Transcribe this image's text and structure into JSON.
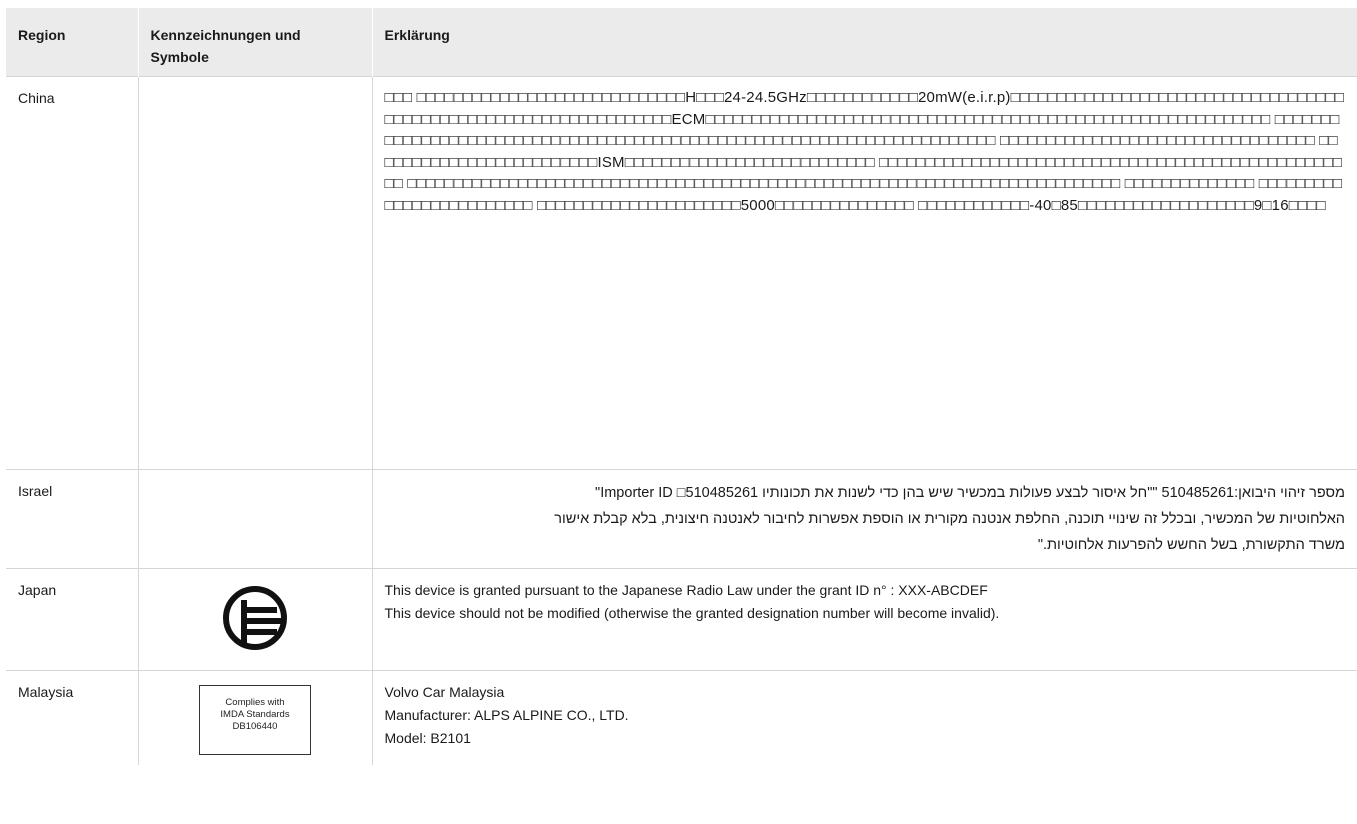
{
  "headers": {
    "region": "Region",
    "symbols": "Kennzeichnungen und Symbole",
    "explanation": "Erklärung"
  },
  "rows": {
    "china": {
      "region": "China",
      "text": "□□□ □□□□□□□□□□□□□□□□□□□□□□□□□□□□□H□□□24-24.5GHz□□□□□□□□□□□□20mW(e.i.r.p)□□□□□□□□□□□□□□□□□□□□□□□□□□□□□□□□□□□□□□□□□□□□□□□□□□□□□□□□□□□□□□□□□□□ECM□□□□□□□□□□□□□□□□□□□□□□□□□□□□□□□□□□□□□□□□□□□□□□□□□□□□□□□□□□□□□ □□□□□□□□□□□□□□□□□□□□□□□□□□□□□□□□□□□□□□□□□□□□□□□□□□□□□□□□□□□□□□□□□□□□□□□□□ □□□□□□□□□□□□□□□□□□□□□□□□□□□□□□□□□□ □□□□□□□□□□□□□□□□□□□□□□□□□ISM□□□□□□□□□□□□□□□□□□□□□□□□□□□ □□□□□□□□□□□□□□□□□□□□□□□□□□□□□□□□□□□□□□□□□□□□□□□□□□□□ □□□□□□□□□□□□□□□□□□□□□□□□□□□□□□□□□□□□□□□□□□□□□□□□□□□□□□□□□□□□□□□□□□□□□□□□□□□□□ □□□□□□□□□□□□□□ □□□□□□□□□□□□□□□□□□□□□□□□□ □□□□□□□□□□□□□□□□□□□□□□5000□□□□□□□□□□□□□□□ □□□□□□□□□□□□-40□85□□□□□□□□□□□□□□□□□□□9□16□□□□"
    },
    "israel": {
      "region": "Israel",
      "lines": [
        "מספר זיהוי היבואן:510485261 \"\"חל איסור לבצע פעולות במכשיר שיש בהן כדי לשנות את תכונותיו Importer ID □510485261\"",
        "האלחוטיות של המכשיר, ובכלל זה שינויי תוכנה, החלפת אנטנה מקורית או הוספת אפשרות לחיבור לאנטנה חיצונית, בלא קבלת אישור",
        "משרד התקשורת, בשל החשש להפרעות אלחוטיות.\""
      ]
    },
    "japan": {
      "region": "Japan",
      "symbol_icon": "japan-giteki-mark-icon",
      "lines": [
        "This device is granted pursuant to the Japanese Radio Law under the grant ID n° : XXX-ABCDEF",
        "This device should not be modified (otherwise the granted designation number will become invalid)."
      ]
    },
    "malaysia": {
      "region": "Malaysia",
      "label_lines": [
        "Complies with",
        "IMDA Standards",
        "DB106440"
      ],
      "lines": [
        "Volvo Car Malaysia",
        "Manufacturer: ALPS ALPINE CO., LTD.",
        "Model: B2101"
      ]
    }
  }
}
